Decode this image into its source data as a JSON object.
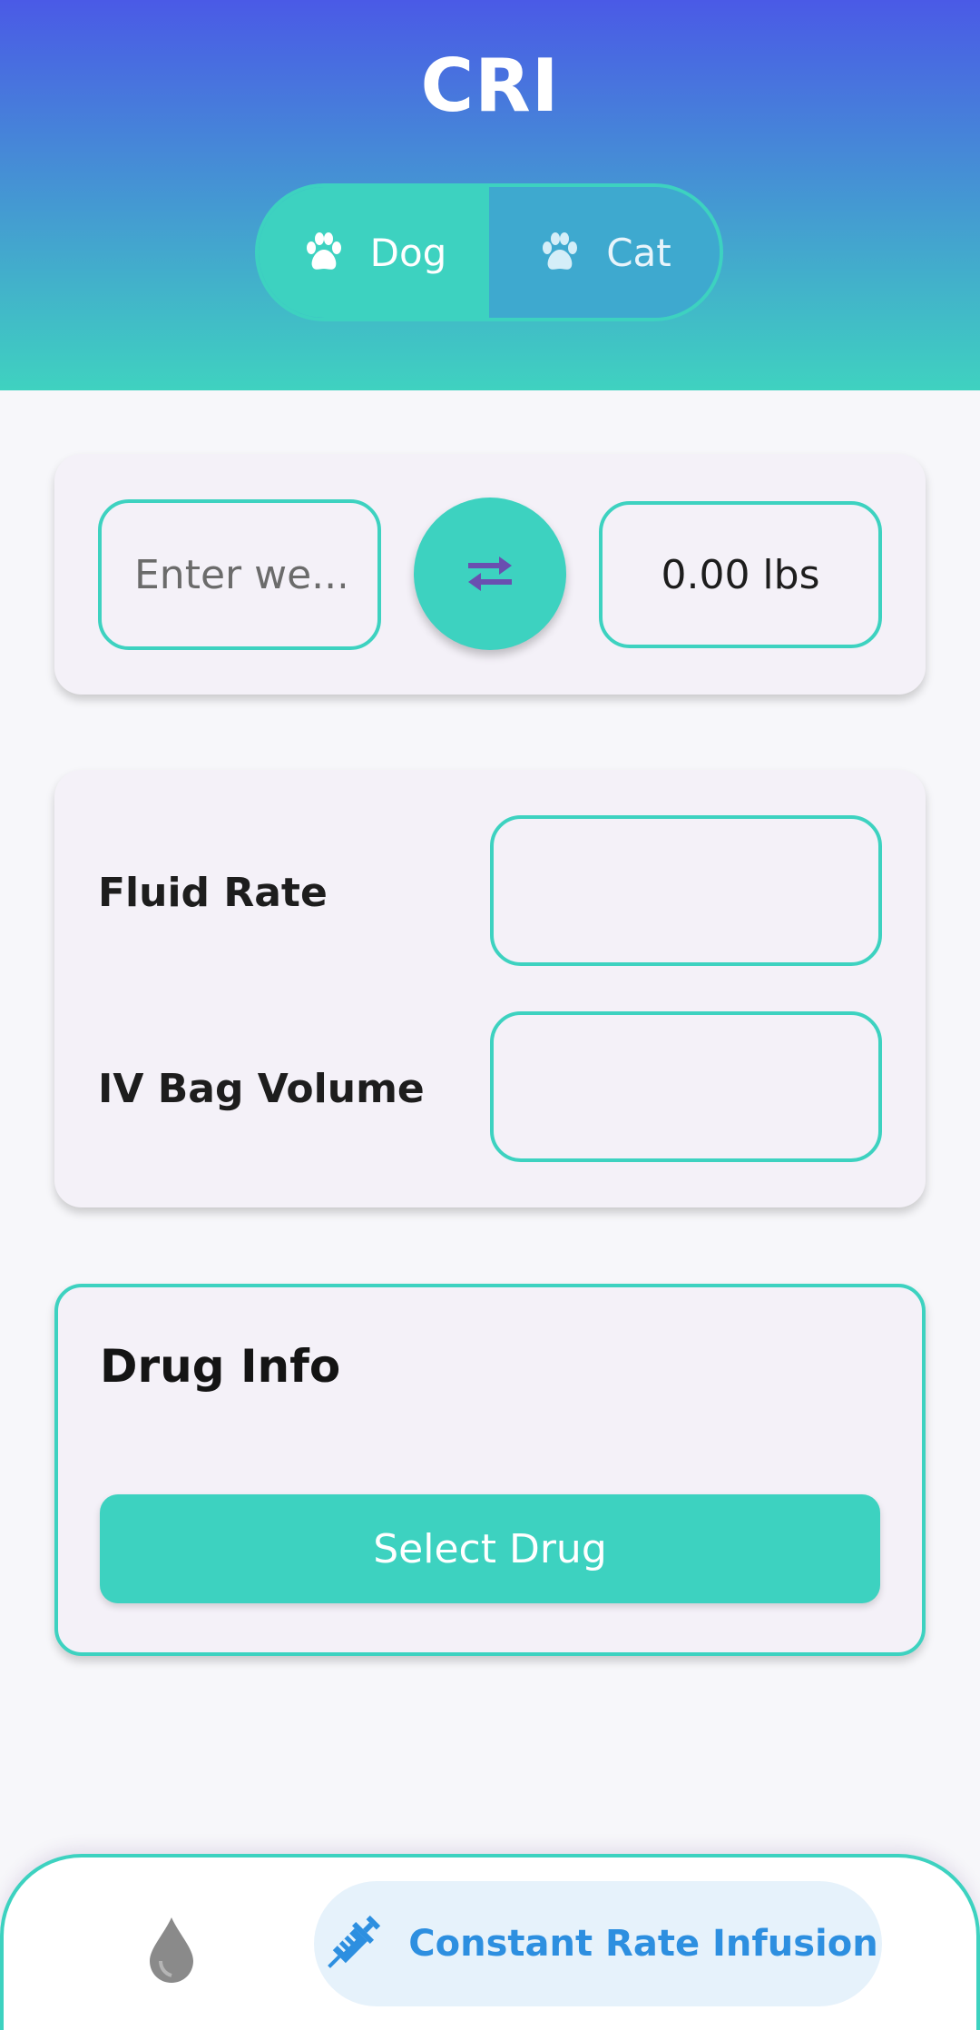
{
  "header": {
    "title": "CRI",
    "species": [
      {
        "label": "Dog",
        "active": true
      },
      {
        "label": "Cat",
        "active": false
      }
    ]
  },
  "weight": {
    "placeholder": "Enter we...",
    "result": "0.00 lbs"
  },
  "fluids": {
    "fluid_rate_label": "Fluid Rate",
    "fluid_rate_value": "",
    "bag_volume_label": "IV Bag Volume",
    "bag_volume_value": ""
  },
  "drug": {
    "title": "Drug Info",
    "select_label": "Select Drug"
  },
  "bottom_nav": {
    "items": [
      {
        "icon": "water-drop-icon",
        "label": ""
      },
      {
        "icon": "syringe-icon",
        "label": "Constant Rate Infusion",
        "active": true
      }
    ]
  },
  "colors": {
    "accent": "#3dd2c0",
    "header_top": "#4a5ae6",
    "active_nav": "#2d8fe0",
    "swap_icon": "#6a4fb0"
  }
}
